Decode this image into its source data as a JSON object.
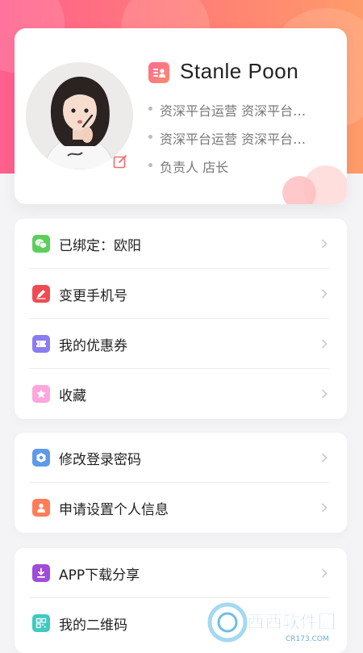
{
  "profile": {
    "name": "Stanle Poon",
    "tags": [
      "资深平台运营 资深平台运营",
      "资深平台运营 资深平台运营",
      "负责人 店长"
    ]
  },
  "menus": {
    "group1": [
      {
        "label": "已绑定：欧阳",
        "icon": "wechat-icon",
        "color": "#5ccf5a"
      },
      {
        "label": "变更手机号",
        "icon": "pencil-icon",
        "color": "#ee4c52"
      },
      {
        "label": "我的优惠券",
        "icon": "coupon-icon",
        "color": "#8b7cf2"
      },
      {
        "label": "收藏",
        "icon": "star-icon",
        "color": "#ffa6dc"
      }
    ],
    "group2": [
      {
        "label": "修改登录密码",
        "icon": "shield-icon",
        "color": "#5f9ae9"
      },
      {
        "label": "申请设置个人信息",
        "icon": "person-icon",
        "color": "#ff7c57"
      }
    ],
    "group3": [
      {
        "label": "APP下载分享",
        "icon": "download-icon",
        "color": "#a14bd9"
      },
      {
        "label": "我的二维码",
        "icon": "qrcode-icon",
        "color": "#3ec9c2"
      }
    ]
  },
  "watermark": {
    "text": "西西软件园",
    "sub": "CR173.COM"
  },
  "colors": {
    "header_gradient": [
      "#ff5f8e",
      "#ff9b69"
    ],
    "accent": "#ff6a8e"
  }
}
